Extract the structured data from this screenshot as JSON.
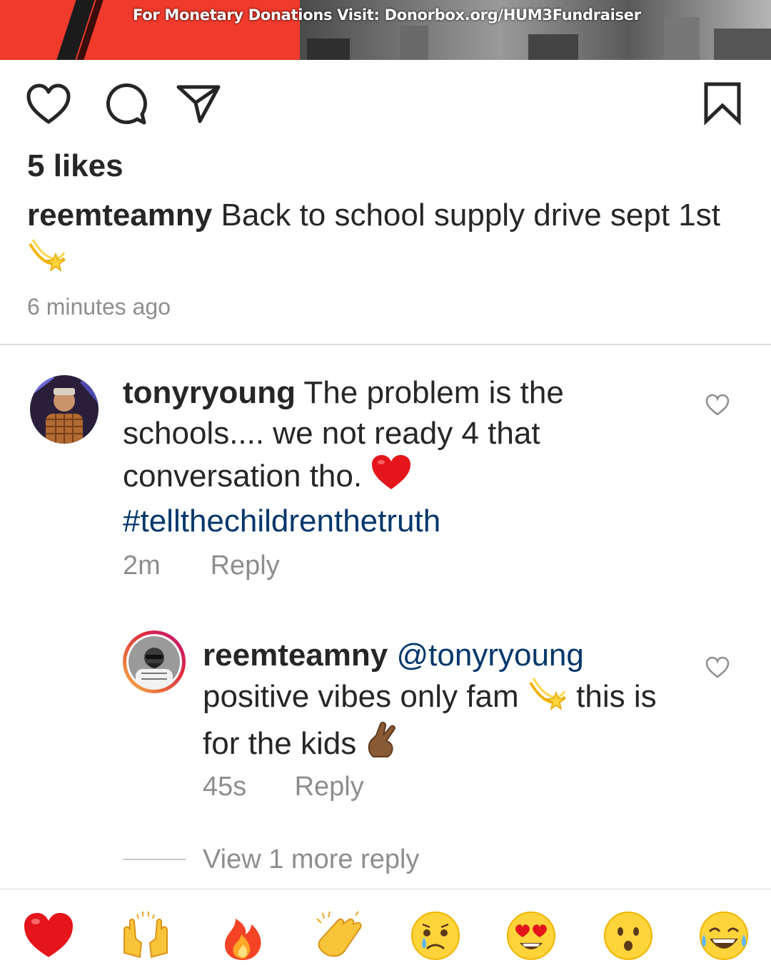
{
  "banner": {
    "text": "For Monetary Donations Visit: Donorbox.org/HUM3Fundraiser"
  },
  "actions": {
    "like_icon": "heart-outline-icon",
    "comment_icon": "comment-bubble-icon",
    "share_icon": "paper-plane-icon",
    "save_icon": "bookmark-icon"
  },
  "post": {
    "likes": "5 likes",
    "author": "reemteamny",
    "caption": "Back to school supply drive sept 1st",
    "caption_emoji": "dizzy-star-emoji",
    "time_ago": "6 minutes ago"
  },
  "comments": [
    {
      "username": "tonyryoung",
      "text": "The problem is the schools.... we not ready 4 that conversation tho.",
      "emoji": "red-heart-emoji",
      "hashtag": "#tellthechildrenthetruth",
      "time": "2m",
      "reply_label": "Reply"
    },
    {
      "username": "reemteamny",
      "mention": "@tonyryoung",
      "text_part1": "positive vibes only fam",
      "text_part2": "this is for the kids",
      "emoji1": "dizzy-star-emoji",
      "emoji2": "crossed-fingers-emoji",
      "time": "45s",
      "reply_label": "Reply"
    }
  ],
  "view_more": "View 1 more reply",
  "quick_reactions": [
    "red-heart-emoji",
    "raising-hands-emoji",
    "fire-emoji",
    "clapping-hands-emoji",
    "crying-face-emoji",
    "heart-eyes-emoji",
    "surprised-face-emoji",
    "tears-of-joy-emoji"
  ],
  "colors": {
    "text": "#262626",
    "secondary": "#8e8e8e",
    "link": "#00376b",
    "banner_red": "#ef3a2c",
    "divider": "#dbdbdb"
  }
}
